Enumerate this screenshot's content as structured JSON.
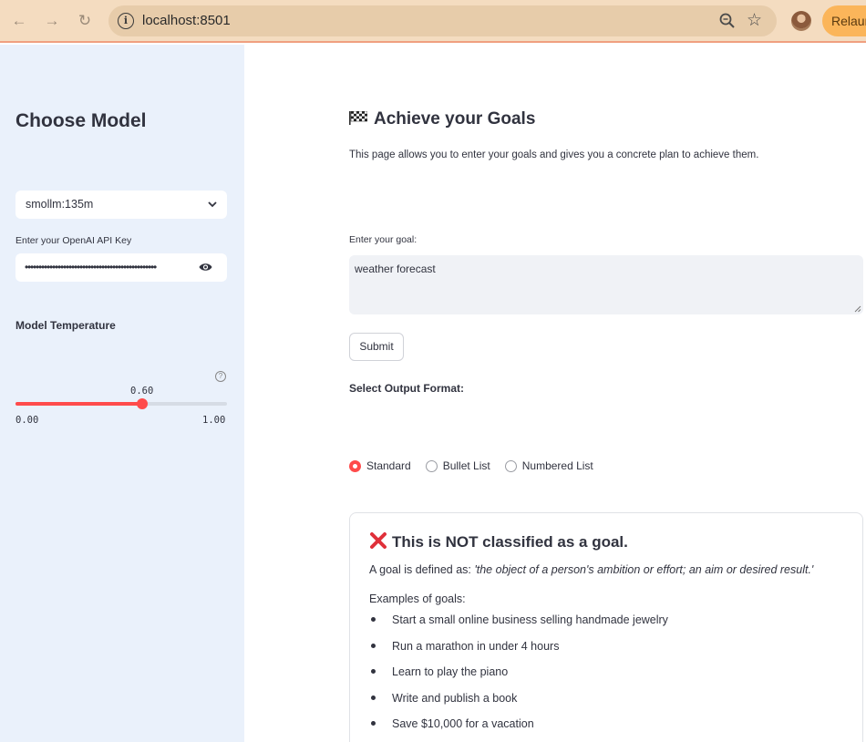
{
  "browser": {
    "url": "localhost:8501",
    "relaunch_label": "Relaun"
  },
  "sidebar": {
    "title": "Choose Model",
    "model_select": {
      "value": "smollm:135m"
    },
    "api_key": {
      "label": "Enter your OpenAI API Key",
      "masked_value": "••••••••••••••••••••••••••••••••••••••••••••••••"
    },
    "temperature": {
      "label": "Model Temperature",
      "value": 0.6,
      "value_label": "0.60",
      "min_label": "0.00",
      "max_label": "1.00",
      "help": "?"
    }
  },
  "main": {
    "title": "Achieve your Goals",
    "description": "This page allows you to enter your goals and gives you a concrete plan to achieve them.",
    "goal_field": {
      "label": "Enter your goal:",
      "value": "weather forecast"
    },
    "submit_label": "Submit",
    "format": {
      "label": "Select Output Format:",
      "options": [
        "Standard",
        "Bullet List",
        "Numbered List"
      ],
      "selected": "Standard"
    },
    "result": {
      "title": "This is NOT classified as a goal.",
      "definition_prefix": "A goal is defined as:",
      "definition_quote": "'the object of a person's ambition or effort; an aim or desired result.'",
      "examples_label": "Examples of goals:",
      "examples": [
        "Start a small online business selling handmade jewelry",
        "Run a marathon in under 4 hours",
        "Learn to play the piano",
        "Write and publish a book",
        "Save $10,000 for a vacation"
      ]
    }
  },
  "colors": {
    "accent": "#ff4b4b",
    "sidebar_bg": "#eaf1fb",
    "chrome_bg": "#f4dcc0"
  }
}
